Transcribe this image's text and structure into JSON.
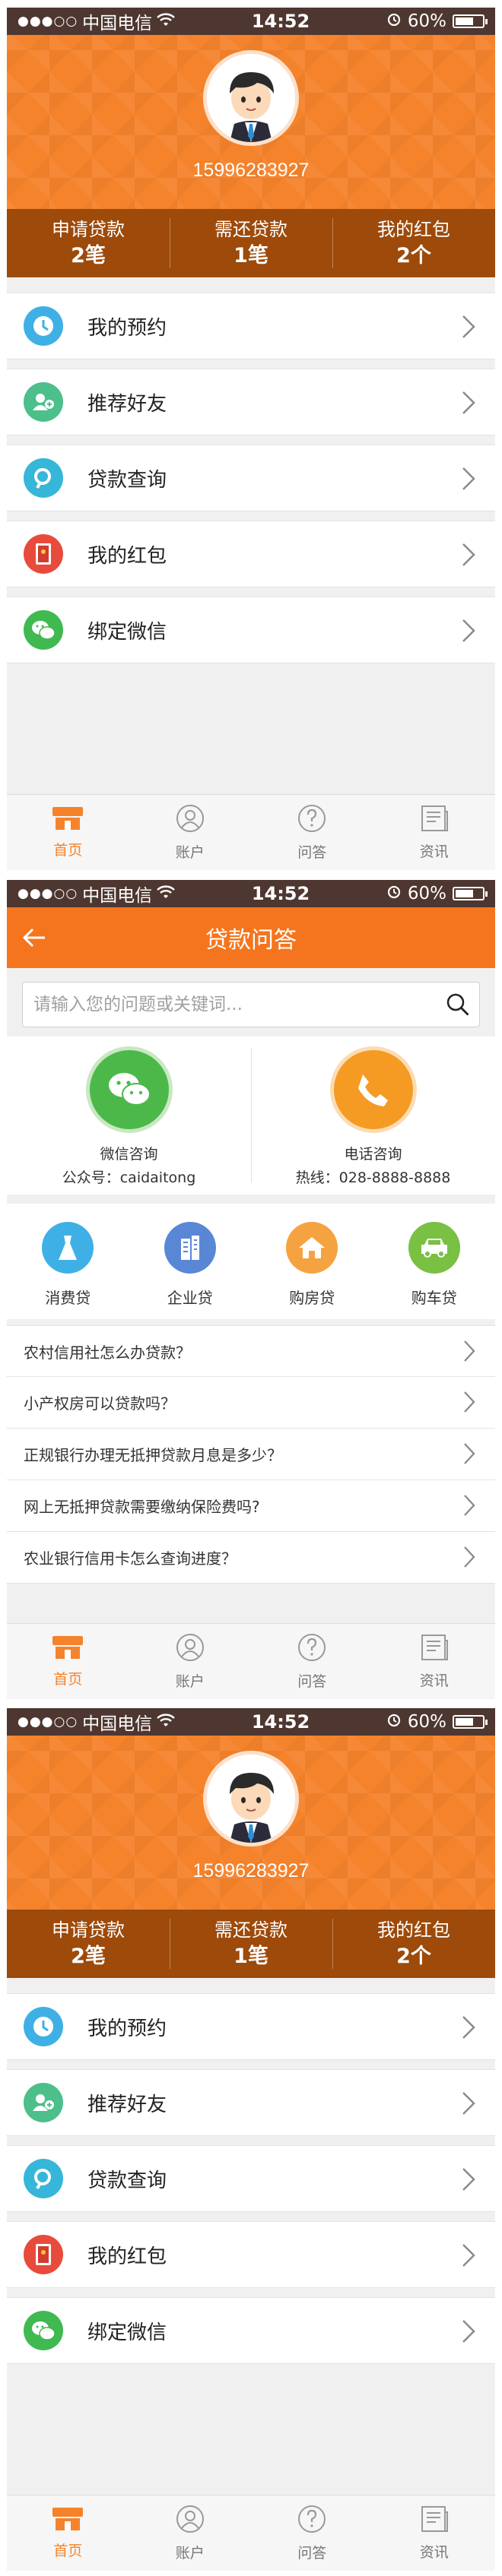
{
  "status_bar": {
    "signal": "●●●○○",
    "carrier": "中国电信",
    "time": "14:52",
    "battery": "60%"
  },
  "profile": {
    "phone": "15996283927",
    "stats": [
      {
        "label": "申请贷款",
        "value": "2笔"
      },
      {
        "label": "需还贷款",
        "value": "1笔"
      },
      {
        "label": "我的红包",
        "value": "2个"
      }
    ]
  },
  "menu": [
    {
      "label": "我的预约",
      "icon": "clock-icon",
      "color": "#3fb0e6"
    },
    {
      "label": "推荐好友",
      "icon": "add-friend-icon",
      "color": "#4cbf8a"
    },
    {
      "label": "贷款查询",
      "icon": "search-icon",
      "color": "#36b6d8"
    },
    {
      "label": "我的红包",
      "icon": "red-envelope-icon",
      "color": "#e84b3c"
    },
    {
      "label": "绑定微信",
      "icon": "wechat-icon",
      "color": "#3fb950"
    }
  ],
  "tabbar": [
    {
      "label": "首页",
      "icon": "home-icon",
      "active": true
    },
    {
      "label": "账户",
      "icon": "account-icon",
      "active": false
    },
    {
      "label": "问答",
      "icon": "question-icon",
      "active": false
    },
    {
      "label": "资讯",
      "icon": "news-icon",
      "active": false
    }
  ],
  "qa_page": {
    "title": "贷款问答",
    "search_placeholder": "请输入您的问题或关键词...",
    "contacts": [
      {
        "title": "微信咨询",
        "sub": "公众号：caidaitong",
        "icon": "wechat-icon",
        "color": "#4cb84a"
      },
      {
        "title": "电话咨询",
        "sub": "热线：028-8888-8888",
        "icon": "phone-icon",
        "color": "#f59a23"
      }
    ],
    "categories": [
      {
        "label": "消费贷",
        "icon": "dress-icon",
        "color": "#3fb0e6"
      },
      {
        "label": "企业贷",
        "icon": "building-icon",
        "color": "#5a86d6"
      },
      {
        "label": "购房贷",
        "icon": "house-icon",
        "color": "#f5a340"
      },
      {
        "label": "购车贷",
        "icon": "car-icon",
        "color": "#79c043"
      }
    ],
    "questions": [
      "农村信用社怎么办贷款？",
      "小产权房可以贷款吗？",
      "正规银行办理无抵押贷款月息是多少？",
      "网上无抵押贷款需要缴纳保险费吗?",
      "农业银行信用卡怎么查询进度？"
    ]
  },
  "colors": {
    "brand_orange": "#f5832c",
    "stats_brown": "#9d4a0a",
    "status_dark": "#4e3730"
  }
}
